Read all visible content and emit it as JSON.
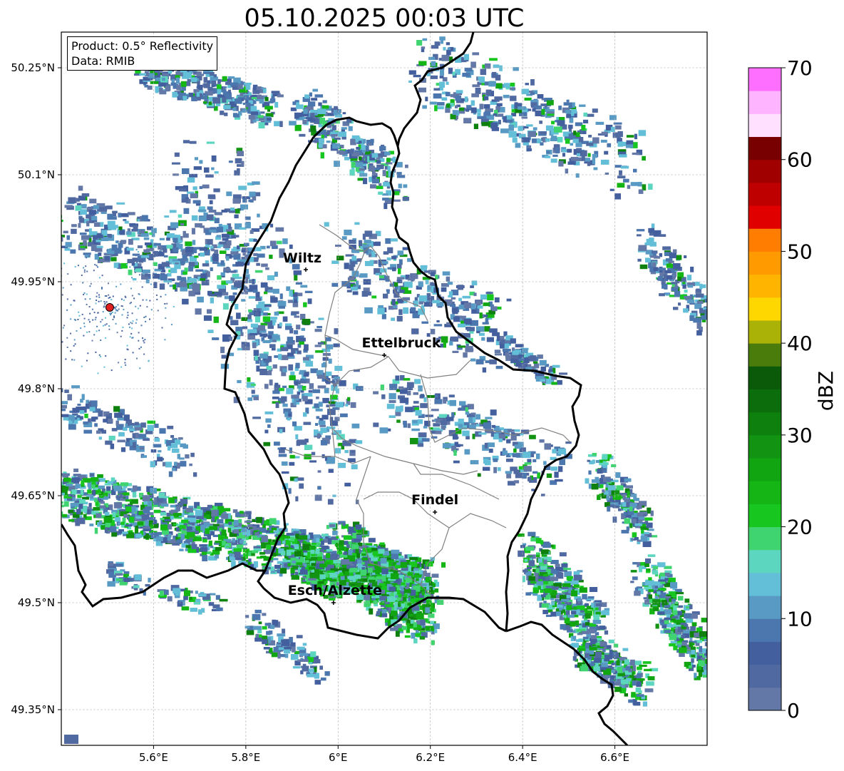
{
  "title": "05.10.2025 00:03 UTC",
  "info": {
    "product": "Product: 0.5° Reflectivity",
    "data": "Data: RMIB"
  },
  "lon_ticks": [
    {
      "value": 5.6,
      "label": "5.6°E"
    },
    {
      "value": 5.8,
      "label": "5.8°E"
    },
    {
      "value": 6.0,
      "label": "6°E"
    },
    {
      "value": 6.2,
      "label": "6.2°E"
    },
    {
      "value": 6.4,
      "label": "6.4°E"
    },
    {
      "value": 6.6,
      "label": "6.6°E"
    }
  ],
  "lat_ticks": [
    {
      "value": 50.25,
      "label": "50.25°N"
    },
    {
      "value": 50.1,
      "label": "50.1°N"
    },
    {
      "value": 49.95,
      "label": "49.95°N"
    },
    {
      "value": 49.8,
      "label": "49.8°N"
    },
    {
      "value": 49.65,
      "label": "49.65°N"
    },
    {
      "value": 49.5,
      "label": "49.5°N"
    },
    {
      "value": 49.35,
      "label": "49.35°N"
    }
  ],
  "map_extent": {
    "lon": [
      5.4,
      6.8
    ],
    "lat": [
      49.3,
      50.3
    ]
  },
  "cities": [
    {
      "name": "Wiltz",
      "lon": 5.93,
      "lat": 49.967
    },
    {
      "name": "Ettelbruck",
      "lon": 6.1,
      "lat": 49.847
    },
    {
      "name": "Findel",
      "lon": 6.21,
      "lat": 49.627
    },
    {
      "name": "Esch/Alzette",
      "lon": 5.99,
      "lat": 49.5
    }
  ],
  "radar_site": {
    "lon": 5.505,
    "lat": 49.914,
    "color": "#e02020"
  },
  "colorbar": {
    "label": "dBZ",
    "min": 0,
    "max": 70,
    "step": 2.5,
    "tick_labels": [
      "0",
      "10",
      "20",
      "30",
      "40",
      "50",
      "60",
      "70"
    ],
    "tick_values": [
      0,
      10,
      20,
      30,
      40,
      50,
      60,
      70
    ],
    "colors": [
      "#6378a6",
      "#5069a1",
      "#435f9e",
      "#4b76ae",
      "#599ac4",
      "#63bfd7",
      "#5dd6c0",
      "#3fd46f",
      "#17c61f",
      "#14b514",
      "#12a512",
      "#129312",
      "#0e800e",
      "#0b6d0b",
      "#0a5a0a",
      "#4a7c0c",
      "#aab107",
      "#fed600",
      "#ffb400",
      "#ff9b00",
      "#ff7d00",
      "#e00000",
      "#be0000",
      "#a00000",
      "#780000",
      "#ffe1ff",
      "#ffb4ff",
      "#ff6fff",
      "#ea38ee"
    ]
  },
  "styles": {
    "border_color": "#000000",
    "canton_color": "#808080",
    "grid_color": "#b0b0b0"
  }
}
